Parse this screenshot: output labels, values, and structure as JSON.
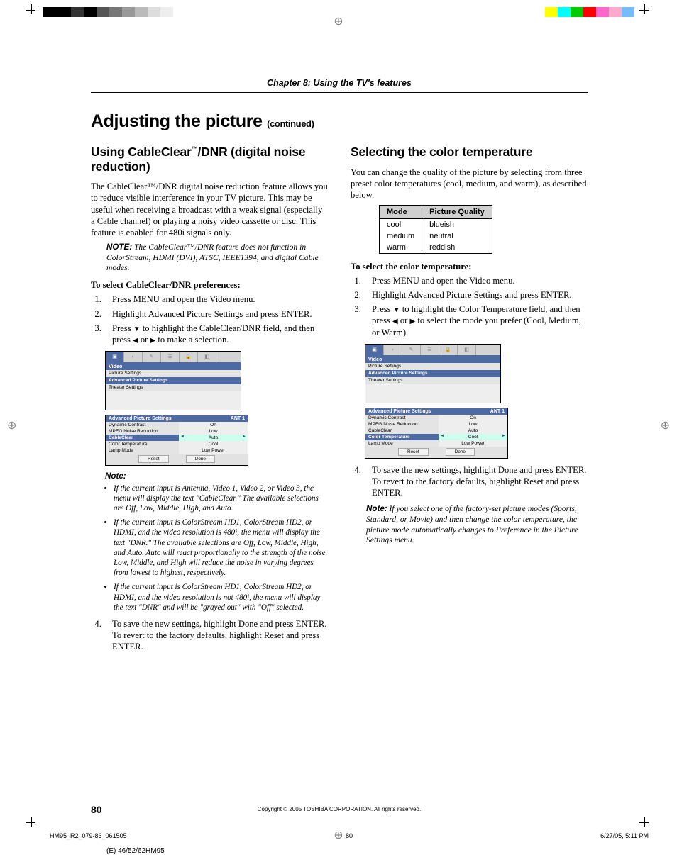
{
  "chapter": "Chapter 8: Using the TV's features",
  "page_title": "Adjusting the picture",
  "page_title_cont": "(continued)",
  "left": {
    "h2_a": "Using CableClear",
    "h2_b": "/DNR (digital noise reduction)",
    "tm": "™",
    "intro": "The CableClear™/DNR digital noise reduction feature allows you to reduce visible interference in your TV picture. This may be useful when receiving a broadcast with a weak signal (especially a Cable channel) or playing a noisy video cassette or disc. This feature is enabled for 480i signals only.",
    "note1_label": "NOTE:",
    "note1": "The CableClear™/DNR feature does not function in ColorStream, HDMI (DVI), ATSC, IEEE1394, and digital Cable modes.",
    "select_hdr": "To select CableClear/DNR preferences:",
    "step1": "Press MENU and open the Video menu.",
    "step2": "Highlight Advanced Picture Settings and press ENTER.",
    "step3a": "Press ",
    "step3b": " to highlight the CableClear/DNR field, and then press ",
    "step3c": " or ",
    "step3d": " to make a selection.",
    "step4": "To save the new settings, highlight Done and press ENTER. To revert to the factory defaults, highlight Reset and press ENTER.",
    "notes_label": "Note:",
    "bullets": [
      "If the current input is Antenna, Video 1, Video 2, or Video 3, the menu will display the text \"CableClear.\" The available selections are Off, Low, Middle, High, and Auto.",
      "If the current input is ColorStream HD1, ColorStream HD2, or HDMI, and the video resolution is 480i, the menu will display the text \"DNR.\" The available selections are Off, Low, Middle, High, and Auto. Auto will react proportionally to the strength of the noise. Low, Middle, and High will reduce the noise in varying degrees from lowest to highest, respectively.",
      "If the current input is ColorStream HD1, ColorStream HD2, or HDMI, and the video resolution is not 480i, the menu will display the text \"DNR\" and will be \"grayed out\" with \"Off\" selected."
    ],
    "osd_label": "Video",
    "osd_items": [
      "Picture Settings",
      "Advanced Picture Settings",
      "Theater Settings"
    ],
    "aps_title": "Advanced Picture Settings",
    "aps_ant": "ANT 1",
    "aps_rows": [
      {
        "k": "Dynamic Contrast",
        "v": "On",
        "sel": false
      },
      {
        "k": "MPEG Noise Reduction",
        "v": "Low",
        "sel": false
      },
      {
        "k": "CableClear",
        "v": "Auto",
        "sel": true
      },
      {
        "k": "Color Temperature",
        "v": "Cool",
        "sel": false
      },
      {
        "k": "Lamp Mode",
        "v": "Low Power",
        "sel": false
      }
    ],
    "aps_reset": "Reset",
    "aps_done": "Done"
  },
  "right": {
    "h2": "Selecting the color temperature",
    "intro": "You can change the quality of the picture by selecting from three preset color temperatures (cool, medium, and warm), as described below.",
    "th1": "Mode",
    "th2": "Picture Quality",
    "rows": [
      [
        "cool",
        "blueish"
      ],
      [
        "medium",
        "neutral"
      ],
      [
        "warm",
        "reddish"
      ]
    ],
    "select_hdr": "To select the color temperature:",
    "step1": "Press MENU and open the Video menu.",
    "step2": "Highlight Advanced Picture Settings and press ENTER.",
    "step3a": "Press ",
    "step3b": " to highlight the Color Temperature field, and then press ",
    "step3c": " or ",
    "step3d": " to select the mode you prefer (Cool, Medium, or Warm).",
    "step4": "To save the new settings, highlight Done and press ENTER. To revert to the factory defaults, highlight Reset and press ENTER.",
    "note2_label": "Note:",
    "note2": "If you select one of the factory-set picture modes (Sports, Standard, or Movie) and then change the color temperature, the picture mode automatically changes to Preference in the Picture Settings menu.",
    "osd_label": "Video",
    "osd_items": [
      "Picture Settings",
      "Advanced Picture Settings",
      "Theater Settings"
    ],
    "aps_title": "Advanced Picture Settings",
    "aps_ant": "ANT 1",
    "aps_rows": [
      {
        "k": "Dynamic Contrast",
        "v": "On",
        "sel": false
      },
      {
        "k": "MPEG Noise Reduction",
        "v": "Low",
        "sel": false
      },
      {
        "k": "CableClear",
        "v": "Auto",
        "sel": false
      },
      {
        "k": "Color Temperature",
        "v": "Cool",
        "sel": true
      },
      {
        "k": "Lamp Mode",
        "v": "Low Power",
        "sel": false
      }
    ],
    "aps_reset": "Reset",
    "aps_done": "Done"
  },
  "copyright": "Copyright © 2005 TOSHIBA CORPORATION. All rights reserved.",
  "page_num": "80",
  "slug_l": "HM95_R2_079-86_061505",
  "slug_c": "80",
  "slug_r": "6/27/05, 5:11 PM",
  "sheet": "(E) 46/52/62HM95",
  "colorbar": [
    "#000",
    "#333",
    "#000",
    "#555",
    "#777",
    "#999",
    "#bbb",
    "#ddd",
    "#eee",
    "#fff",
    "#fff",
    "#fff",
    "#fff",
    "#fff",
    "#fff",
    "#fff",
    "#fff",
    "#ff0",
    "#0ff",
    "#0c0",
    "#f00",
    "#fa8",
    "#f6c",
    "#7bf"
  ]
}
